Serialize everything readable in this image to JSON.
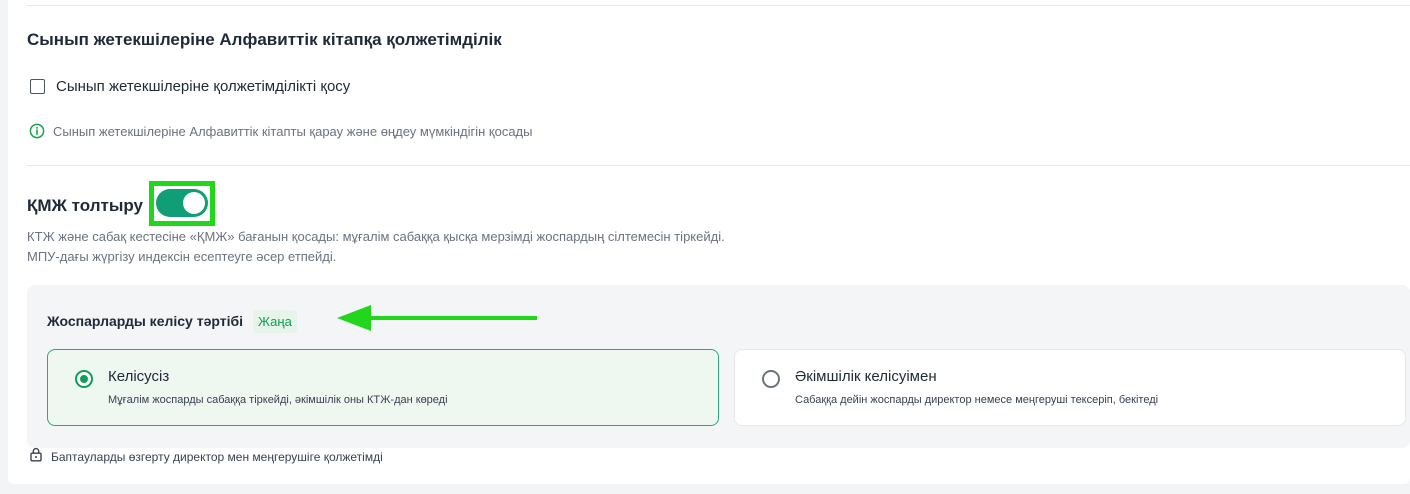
{
  "colors": {
    "accent": "#0f9e76",
    "highlight_box": "#22d61b",
    "arrow": "#22d61b",
    "badge_text": "#0f9e57",
    "badge_bg": "#e6f4ea",
    "selected_border": "#2fa676"
  },
  "alphabet_access": {
    "title": "Сынып жетекшілеріне Алфавиттік кітапқа қолжетімділік",
    "checkbox_label": "Сынып жетекшілеріне қолжетімділікті қосу",
    "checkbox_checked": false,
    "info_icon": "info-circle-icon",
    "info_text": "Сынып жетекшілеріне Алфавиттік кітапты қарау және өңдеу мүмкіндігін қосады"
  },
  "kmzh": {
    "label": "ҚМЖ толтыру",
    "toggle_on": true,
    "description_line1": "КТЖ және сабақ кестесіне «ҚМЖ» бағанын қосады: мұғалім сабаққа қысқа мерзімді жоспардың сілтемесін тіркейді.",
    "description_line2": "МПУ-дағы жүргізу индексін есептеуге әсер етпейді."
  },
  "approval": {
    "title": "Жоспарларды келісу тәртібі",
    "badge": "Жаңа",
    "arrow_icon": "arrow-left-icon",
    "options": [
      {
        "title": "Келісусіз",
        "description": "Мұғалім жоспарды сабаққа тіркейді, әкімшілік оны КТЖ-дан көреді",
        "selected": true
      },
      {
        "title": "Әкімшілік келісуімен",
        "description": "Сабаққа дейін жоспарды директор немесе меңгеруші тексеріп, бекітеді",
        "selected": false
      }
    ],
    "lock_icon": "lock-icon",
    "footer_note": "Баптауларды өзгерту директор мен меңгерушіге қолжетімді"
  }
}
